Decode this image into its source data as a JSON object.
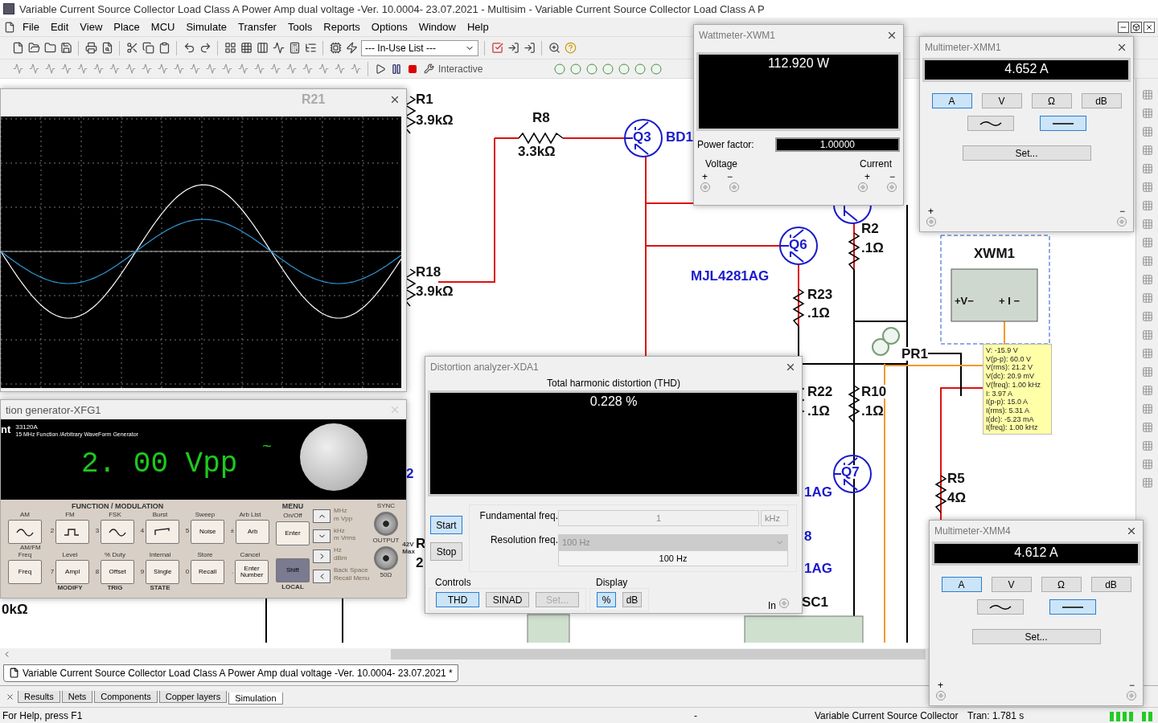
{
  "title": "Variable Current Source Collector Load Class A Power Amp dual voltage -Ver. 10.0004- 23.07.2021 - Multisim - Variable Current Source Collector Load Class A P",
  "menu": [
    "File",
    "Edit",
    "View",
    "Place",
    "MCU",
    "Simulate",
    "Transfer",
    "Tools",
    "Reports",
    "Options",
    "Window",
    "Help"
  ],
  "toolbar": {
    "in_use_list": "--- In-Use List ---",
    "interactive": "Interactive"
  },
  "schematic": {
    "labels": [
      {
        "text": "R1",
        "kind": "part"
      },
      {
        "text": "3.9kΩ",
        "kind": "part"
      },
      {
        "text": "R8",
        "kind": "part"
      },
      {
        "text": "3.3kΩ",
        "kind": "part"
      },
      {
        "text": "Q3",
        "kind": "transistor"
      },
      {
        "text": "BD1",
        "kind": "transistor"
      },
      {
        "text": "R18",
        "kind": "part"
      },
      {
        "text": "3.9kΩ",
        "kind": "part"
      },
      {
        "text": "Q6",
        "kind": "transistor"
      },
      {
        "text": "R2",
        "kind": "part"
      },
      {
        "text": ".1Ω",
        "kind": "part"
      },
      {
        "text": "XWM1",
        "kind": "part"
      },
      {
        "text": "MJL4281AG",
        "kind": "transistor"
      },
      {
        "text": "R23",
        "kind": "part"
      },
      {
        "text": ".1Ω",
        "kind": "part"
      },
      {
        "text": "PR1",
        "kind": "part"
      },
      {
        "text": "R22",
        "kind": "part"
      },
      {
        "text": "R10",
        "kind": "part"
      },
      {
        "text": ".1Ω",
        "kind": "part"
      },
      {
        "text": ".1Ω",
        "kind": "part"
      },
      {
        "text": "2",
        "kind": "transistor"
      },
      {
        "text": "Q7",
        "kind": "transistor"
      },
      {
        "text": "R5",
        "kind": "part"
      },
      {
        "text": "4Ω",
        "kind": "part"
      },
      {
        "text": "1AG",
        "kind": "transistor"
      },
      {
        "text": "8",
        "kind": "transistor"
      },
      {
        "text": "R",
        "kind": "part"
      },
      {
        "text": "2",
        "kind": "part"
      },
      {
        "text": "1AG",
        "kind": "transistor"
      },
      {
        "text": "0kΩ",
        "kind": "part"
      },
      {
        "text": "SC1",
        "kind": "part"
      },
      {
        "text": "+V−",
        "kind": "small"
      },
      {
        "text": "+ I −",
        "kind": "small"
      }
    ]
  },
  "scope": {
    "behind_label": "R21"
  },
  "wattmeter": {
    "title": "Wattmeter-XWM1",
    "reading": "112.920 W",
    "power_factor_label": "Power factor:",
    "power_factor": "1.00000",
    "voltage": "Voltage",
    "current": "Current",
    "plus": "+",
    "minus": "−"
  },
  "multimeters": [
    {
      "title": "Multimeter-XMM1",
      "reading": "4.652 A",
      "modes": [
        {
          "label": "A",
          "selected": true
        },
        {
          "label": "V",
          "selected": false
        },
        {
          "label": "Ω",
          "selected": false
        },
        {
          "label": "dB",
          "selected": false
        }
      ],
      "coupling": [
        {
          "kind": "ac",
          "selected": false
        },
        {
          "kind": "dc",
          "selected": true
        }
      ],
      "set": "Set...",
      "plus": "+",
      "minus": "−"
    },
    {
      "title": "Multimeter-XMM4",
      "reading": "4.612 A",
      "modes": [
        {
          "label": "A",
          "selected": true
        },
        {
          "label": "V",
          "selected": false
        },
        {
          "label": "Ω",
          "selected": false
        },
        {
          "label": "dB",
          "selected": false
        }
      ],
      "coupling": [
        {
          "kind": "ac",
          "selected": false
        },
        {
          "kind": "dc",
          "selected": true
        }
      ],
      "set": "Set...",
      "plus": "+",
      "minus": "−"
    }
  ],
  "probe": {
    "lines": [
      "V: -15.9 V",
      "V(p-p): 60.0 V",
      "V(rms): 21.2 V",
      "V(dc): 20.9 mV",
      "V(freq): 1.00 kHz",
      "I: 3.97 A",
      "I(p-p): 15.0 A",
      "I(rms): 5.31 A",
      "I(dc): -5.23 mA",
      "I(freq): 1.00 kHz"
    ]
  },
  "distortion": {
    "title": "Distortion analyzer-XDA1",
    "heading": "Total harmonic distortion (THD)",
    "reading": "0.228 %",
    "run": [
      {
        "label": "Start",
        "selected": true
      },
      {
        "label": "Stop",
        "selected": false
      }
    ],
    "fundamental_label": "Fundamental freq.",
    "fundamental": "1",
    "fundamental_unit": "kHz",
    "resolution_label": "Resolution freq.",
    "resolution_select": "100 Hz",
    "resolution": "100 Hz",
    "controls_label": "Controls",
    "controls": [
      {
        "label": "THD",
        "selected": true,
        "disabled": false
      },
      {
        "label": "SINAD",
        "selected": false,
        "disabled": false
      },
      {
        "label": "Set...",
        "selected": false,
        "disabled": true
      }
    ],
    "display_label": "Display",
    "display": [
      {
        "label": "%",
        "selected": true
      },
      {
        "label": "dB",
        "selected": false
      }
    ],
    "input": "In"
  },
  "function_generator": {
    "title": "tion generator-XFG1",
    "brand": "nt",
    "model": "33120A",
    "subtitle": "15 MHz Function /Arbitrary WaveForm Generator",
    "display": "2. 00 Vpp",
    "display_mark": "~",
    "section": "FUNCTION / MODULATION",
    "subsection": "AM/FM",
    "row1": [
      {
        "label": "AM",
        "kind": "sine"
      },
      {
        "label": "FM",
        "kind": "square",
        "digit": "2"
      },
      {
        "label": "FSK",
        "kind": "sine",
        "digit": "3"
      },
      {
        "label": "Burst",
        "kind": "ramp",
        "digit": "4"
      },
      {
        "label": "Sweep",
        "kind": "text",
        "key": "Noise",
        "digit": "5"
      },
      {
        "label": "Arb List",
        "kind": "text",
        "key": "Arb",
        "digit": "±"
      }
    ],
    "row2": [
      {
        "label": "Freq",
        "kind": "text",
        "key": "Freq"
      },
      {
        "label": "Level",
        "kind": "text",
        "key": "Ampl",
        "digit": "7"
      },
      {
        "label": "% Duty",
        "kind": "text",
        "key": "Offset",
        "digit": "8"
      },
      {
        "label": "Internal",
        "kind": "text",
        "key": "Single",
        "digit": "9"
      },
      {
        "label": "Store",
        "kind": "text",
        "key": "Recall",
        "digit": "0"
      },
      {
        "label": "Cancel",
        "kind": "text",
        "key": "Enter Number",
        "digit": "."
      }
    ],
    "bottom_labels": [
      "MODIFY",
      "TRIG",
      "STATE"
    ],
    "menu": "MENU",
    "menu_sub": "On/Off",
    "enter": "Enter",
    "shift": "Shift",
    "local": "LOCAL",
    "units": [
      "MHz",
      "m Vpp",
      "kHz",
      "m Vrms",
      "Hz",
      "dBm",
      "Back Space",
      "Recall Menu"
    ],
    "sync": "SYNC",
    "output": "OUTPUT",
    "max": "42V Max",
    "ohm": "50Ω"
  },
  "doc_tab": "Variable Current Source Collector Load Class A Power Amp dual voltage -Ver. 10.0004- 23.07.2021 *",
  "sheet_tabs": [
    {
      "label": "Results",
      "selected": false
    },
    {
      "label": "Nets",
      "selected": false
    },
    {
      "label": "Components",
      "selected": false
    },
    {
      "label": "Copper layers",
      "selected": false
    },
    {
      "label": "Simulation",
      "selected": true
    }
  ],
  "status": {
    "help": "For Help, press F1",
    "dash": "-",
    "doc": "Variable Current Source Collector",
    "tran": "Tran: 1.781 s"
  }
}
